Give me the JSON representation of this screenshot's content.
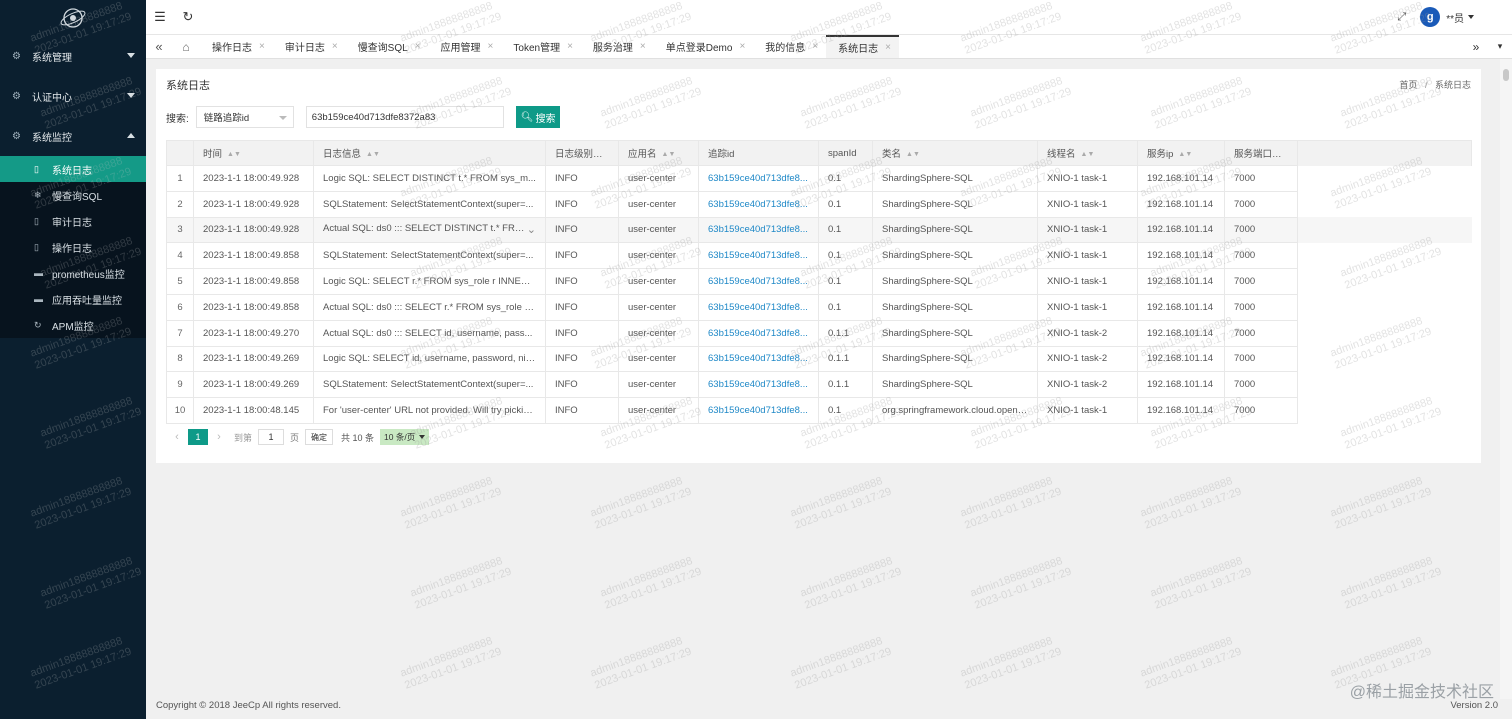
{
  "app": {
    "user": "**员",
    "avatar_letter": "g"
  },
  "sidebar": {
    "groups": [
      {
        "label": "系统管理",
        "icon": "gear-icon"
      },
      {
        "label": "认证中心",
        "icon": "gear-icon"
      },
      {
        "label": "系统监控",
        "icon": "gear-icon"
      }
    ],
    "items": [
      {
        "label": "系统日志",
        "icon": "log-icon",
        "active": true
      },
      {
        "label": "慢查询SQL",
        "icon": "snowflake-icon"
      },
      {
        "label": "审计日志",
        "icon": "log-icon"
      },
      {
        "label": "操作日志",
        "icon": "log-icon"
      },
      {
        "label": "prometheus监控",
        "icon": "monitor-icon"
      },
      {
        "label": "应用吞吐量监控",
        "icon": "monitor-icon"
      },
      {
        "label": "APM监控",
        "icon": "refresh-icon"
      }
    ]
  },
  "tabs": [
    {
      "label": "操作日志"
    },
    {
      "label": "审计日志"
    },
    {
      "label": "慢查询SQL"
    },
    {
      "label": "应用管理"
    },
    {
      "label": "Token管理"
    },
    {
      "label": "服务治理"
    },
    {
      "label": "单点登录Demo"
    },
    {
      "label": "我的信息"
    },
    {
      "label": "系统日志",
      "active": true
    }
  ],
  "page": {
    "title": "系统日志",
    "breadcrumb": [
      "首页",
      "/",
      "系统日志"
    ]
  },
  "search": {
    "label": "搜索:",
    "field": "链路追踪id",
    "value": "63b159ce40d713dfe8372a83",
    "button": "搜索"
  },
  "table": {
    "columns": [
      "时间",
      "日志信息",
      "日志级别",
      "应用名",
      "追踪id",
      "spanId",
      "类名",
      "线程名",
      "服务ip",
      "服务端口"
    ],
    "rows": [
      [
        "1",
        "2023-1-1 18:00:49.928",
        "Logic SQL: SELECT DISTINCT t.* FROM sys_m...",
        "INFO",
        "user-center",
        "63b159ce40d713dfe8...",
        "0.1",
        "ShardingSphere-SQL",
        "XNIO-1 task-1",
        "192.168.101.14",
        "7000"
      ],
      [
        "2",
        "2023-1-1 18:00:49.928",
        "SQLStatement: SelectStatementContext(super=...",
        "INFO",
        "user-center",
        "63b159ce40d713dfe8...",
        "0.1",
        "ShardingSphere-SQL",
        "XNIO-1 task-1",
        "192.168.101.14",
        "7000"
      ],
      [
        "3",
        "2023-1-1 18:00:49.928",
        "Actual SQL: ds0 ::: SELECT DISTINCT t.* FROM...",
        "INFO",
        "user-center",
        "63b159ce40d713dfe8...",
        "0.1",
        "ShardingSphere-SQL",
        "XNIO-1 task-1",
        "192.168.101.14",
        "7000"
      ],
      [
        "4",
        "2023-1-1 18:00:49.858",
        "SQLStatement: SelectStatementContext(super=...",
        "INFO",
        "user-center",
        "63b159ce40d713dfe8...",
        "0.1",
        "ShardingSphere-SQL",
        "XNIO-1 task-1",
        "192.168.101.14",
        "7000"
      ],
      [
        "5",
        "2023-1-1 18:00:49.858",
        "Logic SQL: SELECT r.* FROM sys_role r INNER ...",
        "INFO",
        "user-center",
        "63b159ce40d713dfe8...",
        "0.1",
        "ShardingSphere-SQL",
        "XNIO-1 task-1",
        "192.168.101.14",
        "7000"
      ],
      [
        "6",
        "2023-1-1 18:00:49.858",
        "Actual SQL: ds0 ::: SELECT r.* FROM sys_role r ...",
        "INFO",
        "user-center",
        "63b159ce40d713dfe8...",
        "0.1",
        "ShardingSphere-SQL",
        "XNIO-1 task-1",
        "192.168.101.14",
        "7000"
      ],
      [
        "7",
        "2023-1-1 18:00:49.270",
        "Actual SQL: ds0 ::: SELECT id, username, pass...",
        "INFO",
        "user-center",
        "63b159ce40d713dfe8...",
        "0.1.1",
        "ShardingSphere-SQL",
        "XNIO-1 task-2",
        "192.168.101.14",
        "7000"
      ],
      [
        "8",
        "2023-1-1 18:00:49.269",
        "Logic SQL: SELECT id, username, password, nic...",
        "INFO",
        "user-center",
        "63b159ce40d713dfe8...",
        "0.1.1",
        "ShardingSphere-SQL",
        "XNIO-1 task-2",
        "192.168.101.14",
        "7000"
      ],
      [
        "9",
        "2023-1-1 18:00:49.269",
        "SQLStatement: SelectStatementContext(super=...",
        "INFO",
        "user-center",
        "63b159ce40d713dfe8...",
        "0.1.1",
        "ShardingSphere-SQL",
        "XNIO-1 task-2",
        "192.168.101.14",
        "7000"
      ],
      [
        "10",
        "2023-1-1 18:00:48.145",
        "For 'user-center' URL not provided. Will try pickin...",
        "INFO",
        "user-center",
        "63b159ce40d713dfe8...",
        "0.1",
        "org.springframework.cloud.openf...",
        "XNIO-1 task-1",
        "192.168.101.14",
        "7000"
      ]
    ]
  },
  "pager": {
    "current": "1",
    "goto_label": "到第",
    "page_input": "1",
    "page_unit": "页",
    "confirm": "确定",
    "total": "共 10 条",
    "page_size": "10 条/页"
  },
  "footer": {
    "copyright": "Copyright © 2018 JeeCp All rights reserved.",
    "version": "Version 2.0",
    "site_mark": "@稀土掘金技术社区"
  },
  "watermark": {
    "line1": "admin18888888888",
    "line2": "2023-01-01 19:17:29"
  },
  "colors": {
    "sidebar_bg": "#0b1f2f",
    "accent": "#0e9a88",
    "link": "#1e88c7"
  }
}
